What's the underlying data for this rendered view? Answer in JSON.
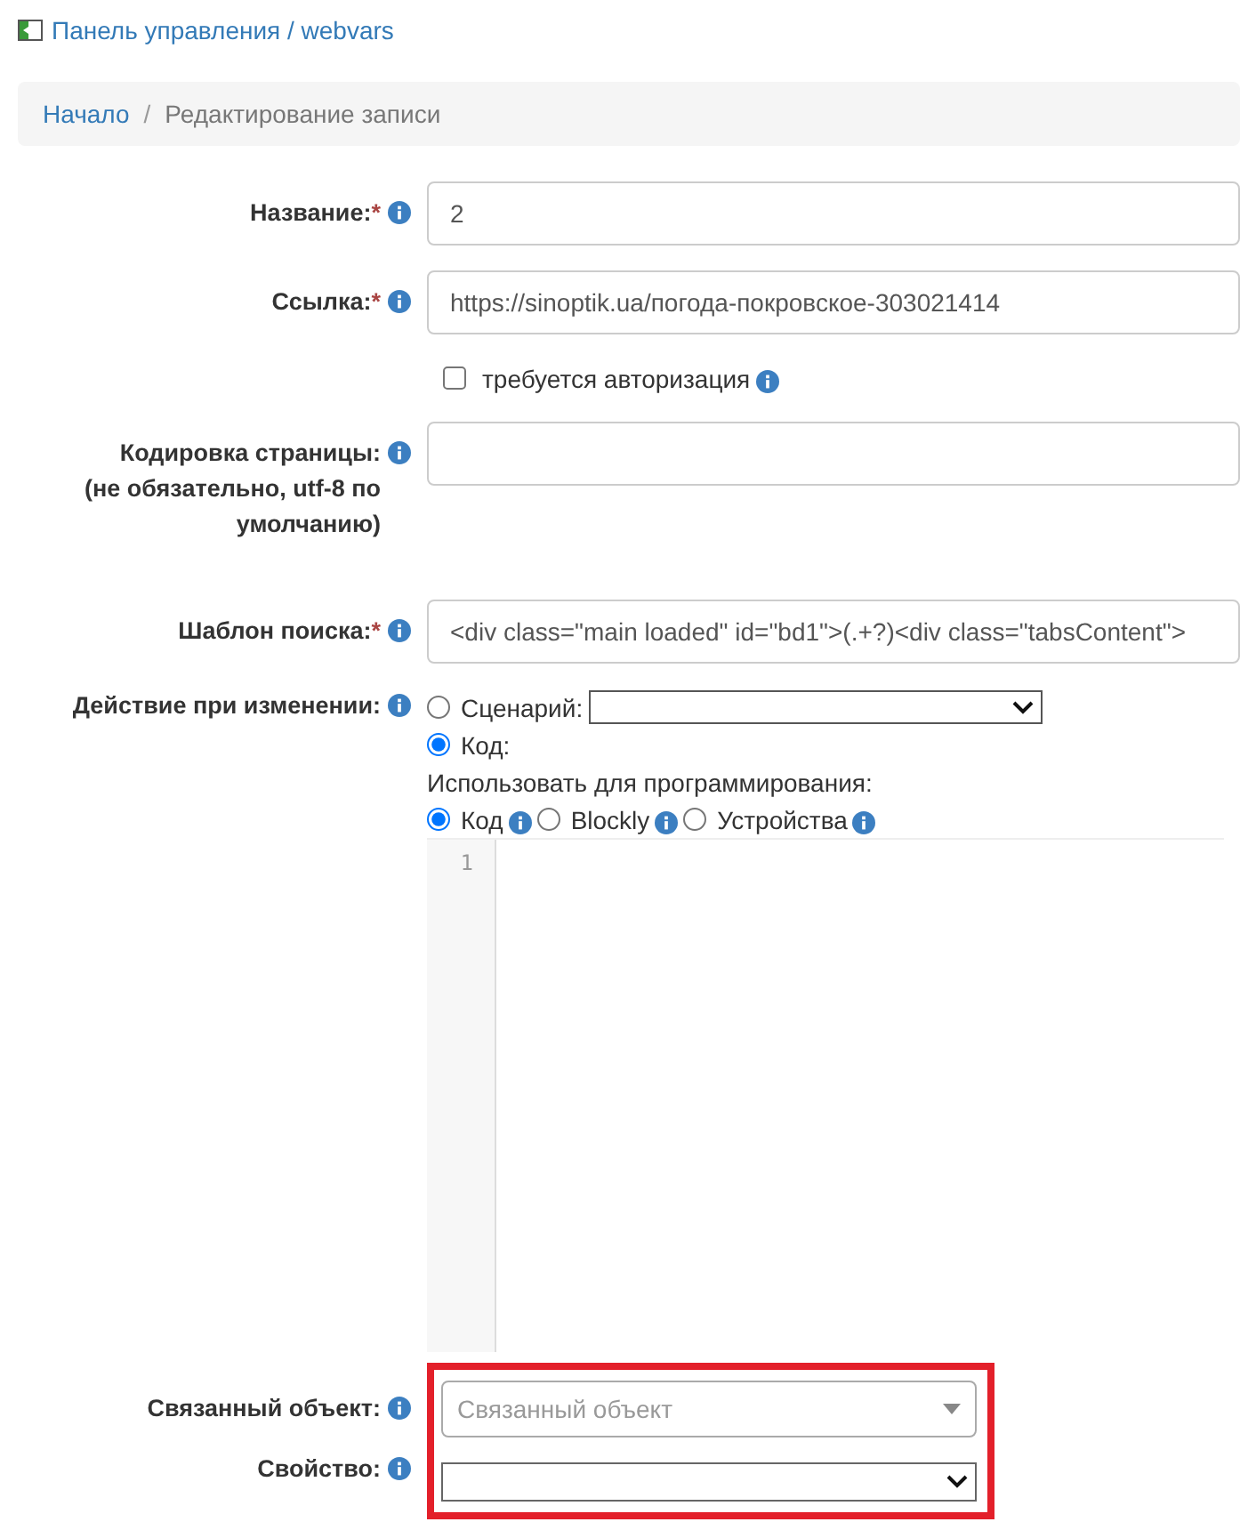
{
  "header": {
    "title": "Панель управления / webvars"
  },
  "breadcrumb": {
    "separator": "/",
    "items": [
      {
        "label": "Начало",
        "kind": "link"
      },
      {
        "label": "Редактирование записи",
        "kind": "current"
      }
    ]
  },
  "rows": [
    {
      "kind": "input",
      "label": "Название:",
      "required_mark": "*",
      "value": "2"
    },
    {
      "kind": "input",
      "label": "Ссылка:",
      "required_mark": "*",
      "value": "https://sinoptik.ua/погода-покровское-303021414"
    },
    {
      "kind": "checkbox",
      "label": "требуется авторизация",
      "checked": false
    },
    {
      "kind": "input",
      "label": "Кодировка страницы:",
      "note": "(не обязательно, utf-8 по умолчанию)"
    },
    {
      "kind": "input",
      "label": "Шаблон поиска:",
      "required_mark": "*",
      "value": "<div class=\"main loaded\" id=\"bd1\">(.+?)<div class=\"tabsContent\">"
    },
    {
      "kind": "action",
      "label": "Действие при изменении:",
      "options": [
        {
          "label": "Сценарий:",
          "selected": false,
          "kind": "with_select"
        },
        {
          "label": "Код:",
          "selected": true,
          "kind": "plain"
        }
      ],
      "use_label": "Использовать для программирования:",
      "modes": [
        {
          "label": "Код",
          "selected": true
        },
        {
          "label": "Blockly",
          "selected": false
        },
        {
          "label": "Устройства",
          "selected": false
        }
      ],
      "line_numbers": [
        "1"
      ]
    }
  ],
  "linked": [
    {
      "kind": "combo",
      "label": "Связанный объект:",
      "placeholder": "Связанный объект"
    },
    {
      "kind": "select",
      "label": "Свойство:"
    }
  ]
}
